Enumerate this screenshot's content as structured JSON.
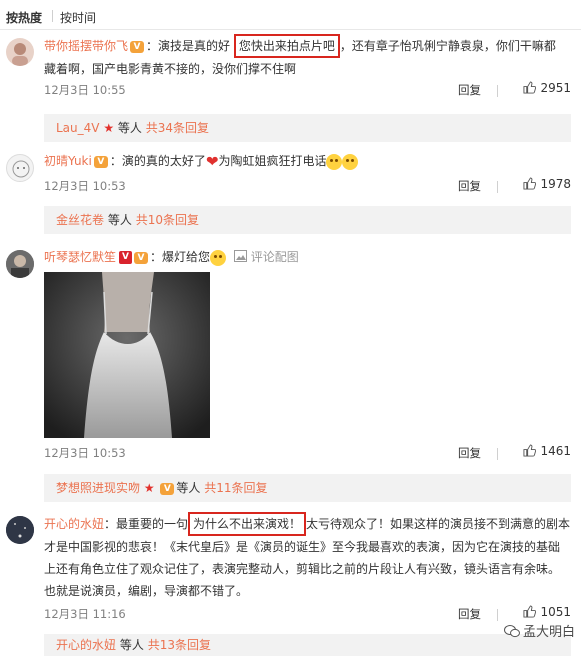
{
  "sort_tabs": [
    "按热度",
    "按时间"
  ],
  "comments": [
    {
      "user": "带你摇摆带你飞",
      "text_before": "：演技是真的好",
      "highlight": "您快出来拍点片吧",
      "text_after": "，还有章子怡巩俐宁静袁泉，你们干嘛都",
      "text_line2": "藏着啊，国产电影青黄不接的，没你们撑不住啊",
      "time": "12月3日 10:55",
      "reply_label": "回复",
      "likes": "2951",
      "sub_user": "Lau_4V",
      "sub_text": "等人",
      "sub_count": "共34条回复"
    },
    {
      "user": "初晴Yuki",
      "text_before": "：演的真的太好了",
      "text_after": "为陶虹姐疯狂打电话",
      "time": "12月3日 10:53",
      "reply_label": "回复",
      "likes": "1978",
      "sub_user": "金丝花卷",
      "sub_text": "等人",
      "sub_count": "共10条回复"
    },
    {
      "user": "听琴瑟忆默笙",
      "text_before": "：爆灯给您",
      "review_link": "评论配图",
      "time": "12月3日 10:53",
      "reply_label": "回复",
      "likes": "1461",
      "sub_user": "梦想照进现实吻",
      "sub_text": "等人",
      "sub_count": "共11条回复"
    },
    {
      "user": "开心的水妞",
      "text_before": "：最重要的一句",
      "highlight": "为什么不出来演戏！",
      "text_after": "太亏待观众了！如果这样的演员接不到满意的剧本",
      "text_line2": "才是中国影视的悲哀！《末代皇后》是《演员的诞生》至今我最喜欢的表演，因为它在演技的基础",
      "text_line3": "上还有角色立住了观众记住了，表演完整动人，剪辑比之前的片段让人有兴致，镜头语言有余味。",
      "text_line4": "也就是说演员，编剧，导演都不错了。",
      "time": "12月3日 11:16",
      "reply_label": "回复",
      "likes": "1051",
      "sub_user": "开心的水妞",
      "sub_text": "等人",
      "sub_count": "共13条回复"
    }
  ],
  "watermark": "孟大明白",
  "colors": {
    "username": "#eb7350",
    "highlight_border": "#d8261e",
    "subreply_bg": "#f2f2f2"
  }
}
